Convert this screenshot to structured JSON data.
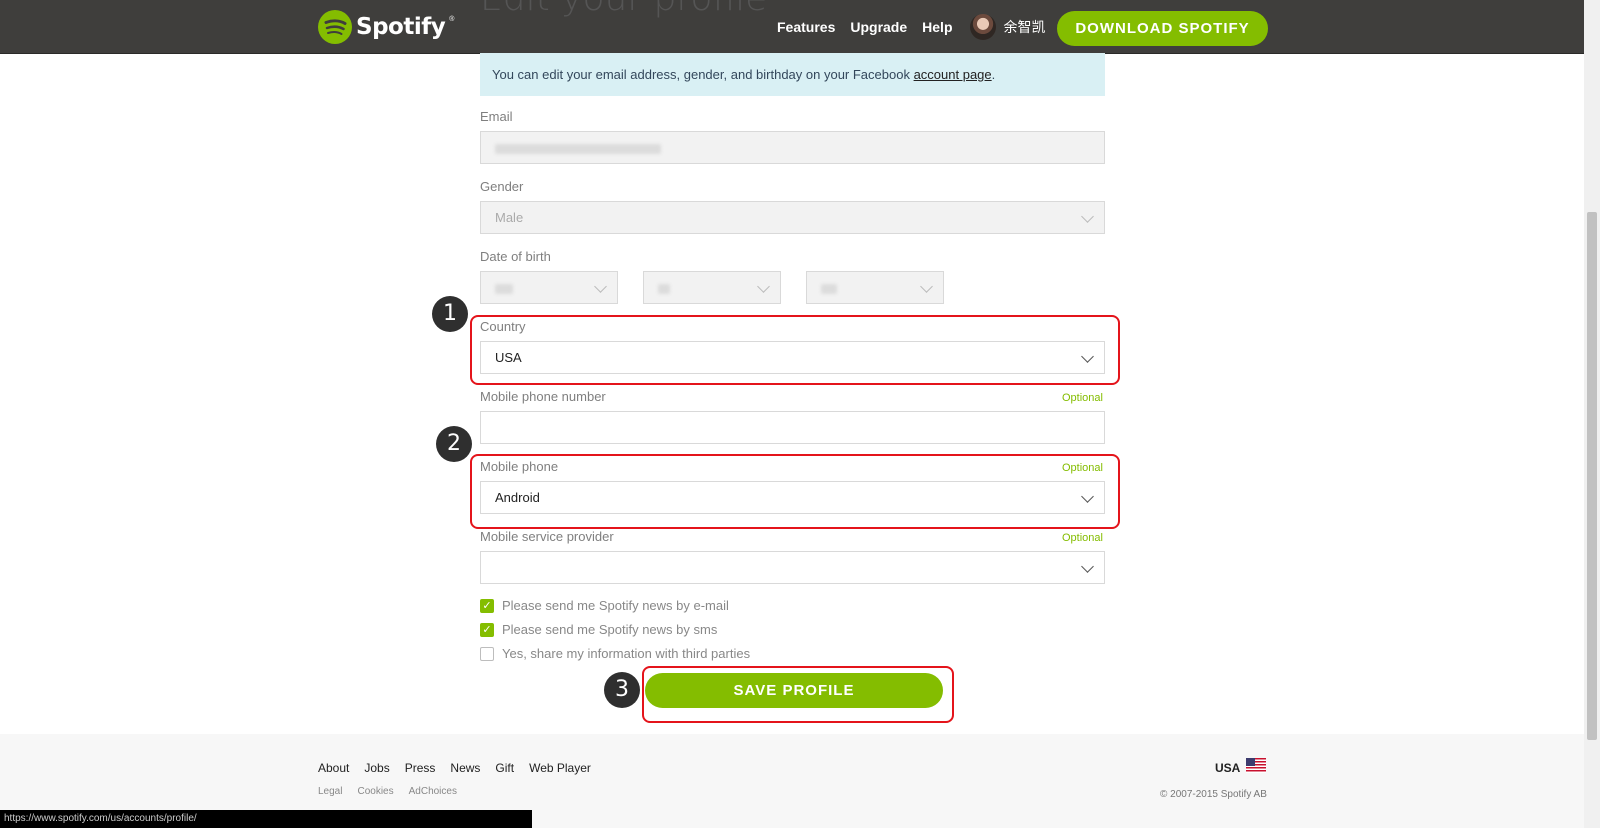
{
  "header": {
    "page_title": "Edit your profile",
    "logo_text": "Spotify",
    "logo_tm": "®",
    "nav": [
      "Features",
      "Upgrade",
      "Help"
    ],
    "username": "余智凯",
    "download_label": "DOWNLOAD SPOTIFY"
  },
  "notice": {
    "text_before": "You can edit your email address, gender, and birthday on your Facebook ",
    "link": "account page",
    "text_after": "."
  },
  "form": {
    "email_label": "Email",
    "gender_label": "Gender",
    "gender_value": "Male",
    "dob_label": "Date of birth",
    "country_label": "Country",
    "country_value": "USA",
    "mobile_number_label": "Mobile phone number",
    "mobile_phone_label": "Mobile phone",
    "mobile_phone_value": "Android",
    "provider_label": "Mobile service provider",
    "optional": "Optional",
    "checkboxes": [
      {
        "label": "Please send me Spotify news by e-mail",
        "checked": true
      },
      {
        "label": "Please send me Spotify news by sms",
        "checked": true
      },
      {
        "label": "Yes, share my information with third parties",
        "checked": false
      }
    ],
    "save_label": "SAVE PROFILE"
  },
  "annotations": [
    "1",
    "2",
    "3"
  ],
  "colors": {
    "accent": "#84bd00",
    "header": "#3f3e3c",
    "highlight": "#e4141b"
  },
  "footer": {
    "links": [
      "About",
      "Jobs",
      "Press",
      "News",
      "Gift",
      "Web Player"
    ],
    "small_links": [
      "Legal",
      "Cookies",
      "AdChoices"
    ],
    "country": "USA",
    "copyright": "© 2007-2015 Spotify AB"
  },
  "status_url": "https://www.spotify.com/us/accounts/profile/"
}
